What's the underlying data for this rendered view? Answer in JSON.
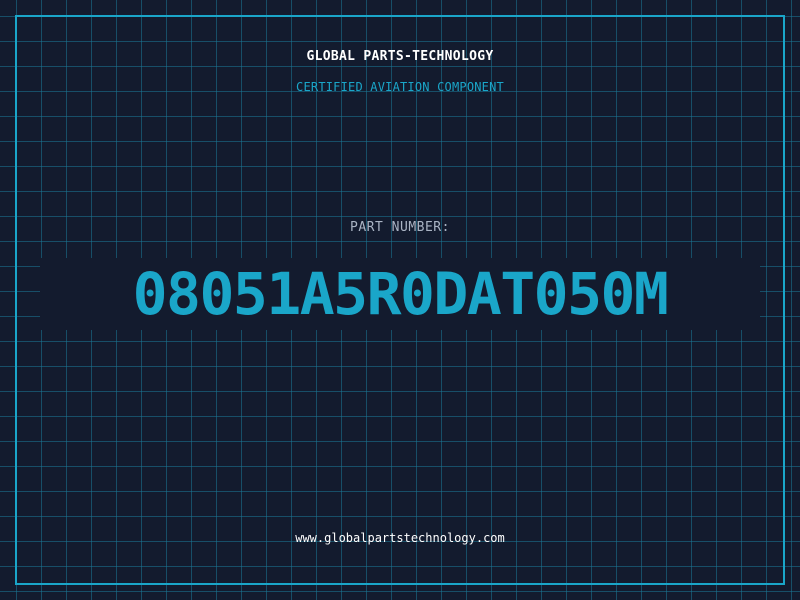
{
  "header": {
    "brand": "GLOBAL PARTS-TECHNOLOGY",
    "tagline": "CERTIFIED AVIATION COMPONENT"
  },
  "part": {
    "label": "PART NUMBER:",
    "number": "08051A5R0DAT050M"
  },
  "footer": {
    "website": "www.globalpartstechnology.com"
  },
  "colors": {
    "background": "#131b2e",
    "grid": "#1a7896",
    "accent": "#1aa6c9",
    "label": "#aab4c4",
    "white": "#ffffff"
  }
}
